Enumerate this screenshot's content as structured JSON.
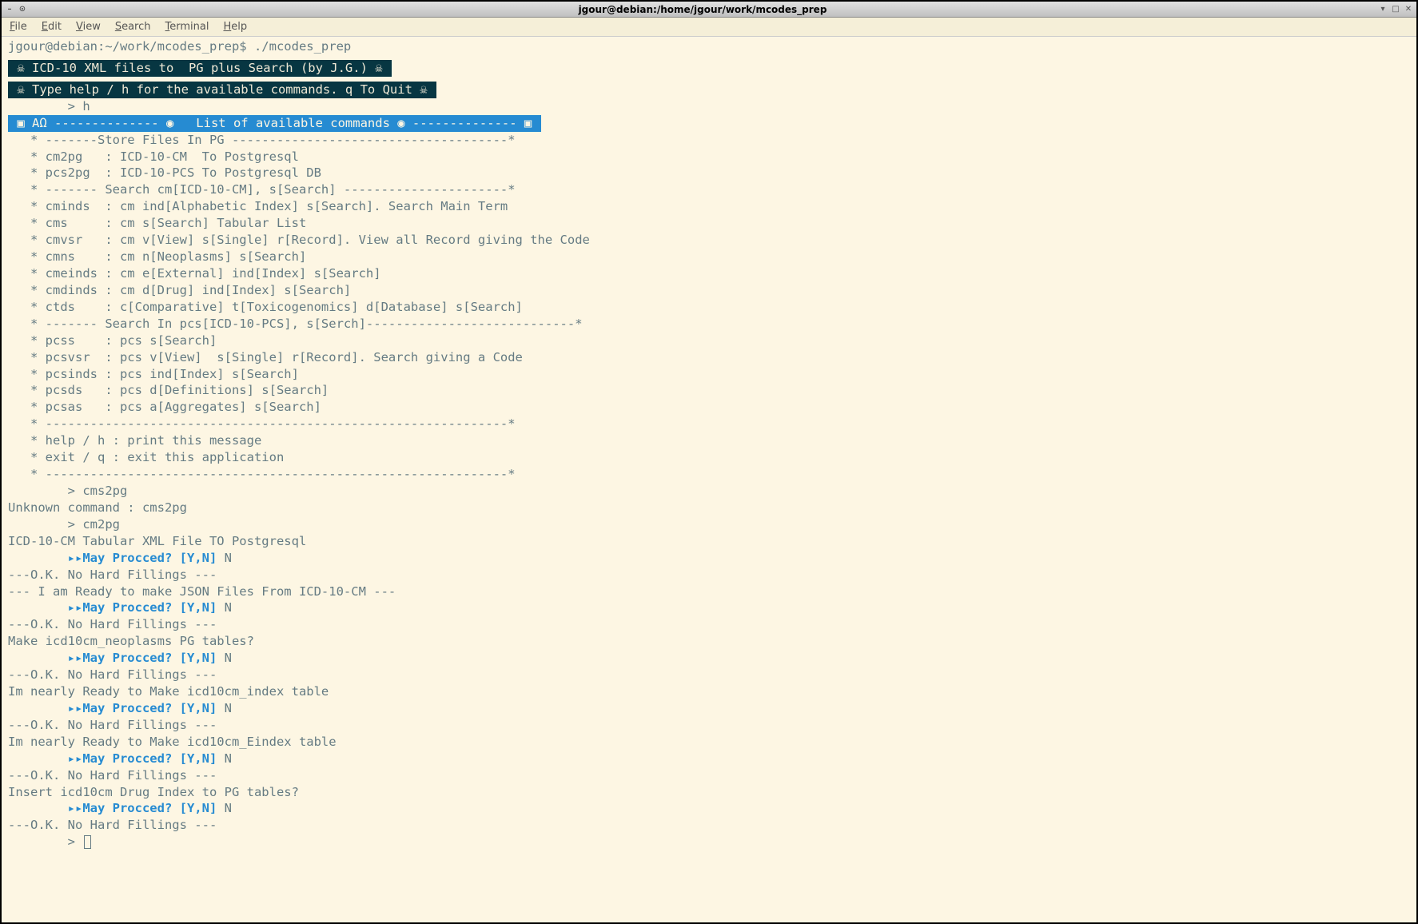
{
  "window": {
    "title": "jgour@debian:/home/jgour/work/mcodes_prep"
  },
  "menu": {
    "items": [
      "File",
      "Edit",
      "View",
      "Search",
      "Terminal",
      "Help"
    ]
  },
  "shell_prompt": "jgour@debian:~/work/mcodes_prep$ ./mcodes_prep",
  "banner1": " ☠ ICD-10 XML files to  PG plus Search (by J.G.) ☠ ",
  "banner2": " ☠ Type help / h for the available commands. q To Quit ☠ ",
  "input1": "        > h",
  "banner3": " ▣ AΩ -------------- ◉   List of available commands ◉ -------------- ▣ ",
  "help_lines": [
    "",
    "   * -------Store Files In PG -------------------------------------*",
    "   * cm2pg   : ICD-10-CM  To Postgresql",
    "   * pcs2pg  : ICD-10-PCS To Postgresql DB",
    "   * ------- Search cm[ICD-10-CM], s[Search] ----------------------*",
    "   * cminds  : cm ind[Alphabetic Index] s[Search]. Search Main Term",
    "   * cms     : cm s[Search] Tabular List",
    "   * cmvsr   : cm v[View] s[Single] r[Record]. View all Record giving the Code",
    "   * cmns    : cm n[Neoplasms] s[Search]",
    "   * cmeinds : cm e[External] ind[Index] s[Search]",
    "   * cmdinds : cm d[Drug] ind[Index] s[Search]",
    "   * ctds    : c[Comparative] t[Toxicogenomics] d[Database] s[Search]",
    "   * ------- Search In pcs[ICD-10-PCS], s[Serch]----------------------------*",
    "   * pcss    : pcs s[Search]",
    "   * pcsvsr  : pcs v[View]  s[Single] r[Record]. Search giving a Code",
    "   * pcsinds : pcs ind[Index] s[Search]",
    "   * pcsds   : pcs d[Definitions] s[Search]",
    "   * pcsas   : pcs a[Aggregates] s[Search]",
    "   * --------------------------------------------------------------*",
    "   * help / h : print this message",
    "   * exit / q : exit this application",
    "   * --------------------------------------------------------------*",
    ""
  ],
  "session": [
    {
      "type": "in",
      "text": "        > cms2pg"
    },
    {
      "type": "out",
      "text": "Unknown command : cms2pg"
    },
    {
      "type": "in",
      "text": "        > cm2pg"
    },
    {
      "type": "out",
      "text": "ICD-10-CM Tabular XML File TO Postgresql"
    },
    {
      "type": "ask",
      "prompt": "▸▸May Procced? [Y,N]",
      "answer": " N"
    },
    {
      "type": "out",
      "text": "---O.K. No Hard Fillings ---"
    },
    {
      "type": "out",
      "text": "--- I am Ready to make JSON Files From ICD-10-CM ---"
    },
    {
      "type": "ask",
      "prompt": "▸▸May Procced? [Y,N]",
      "answer": " N"
    },
    {
      "type": "out",
      "text": "---O.K. No Hard Fillings ---"
    },
    {
      "type": "out",
      "text": "Make icd10cm_neoplasms PG tables?"
    },
    {
      "type": "ask",
      "prompt": "▸▸May Procced? [Y,N]",
      "answer": " N"
    },
    {
      "type": "out",
      "text": "---O.K. No Hard Fillings ---"
    },
    {
      "type": "out",
      "text": "Im nearly Ready to Make icd10cm_index table"
    },
    {
      "type": "ask",
      "prompt": "▸▸May Procced? [Y,N]",
      "answer": " N"
    },
    {
      "type": "out",
      "text": "---O.K. No Hard Fillings ---"
    },
    {
      "type": "out",
      "text": "Im nearly Ready to Make icd10cm_Eindex table"
    },
    {
      "type": "ask",
      "prompt": "▸▸May Procced? [Y,N]",
      "answer": " N"
    },
    {
      "type": "out",
      "text": "---O.K. No Hard Fillings ---"
    },
    {
      "type": "out",
      "text": "Insert icd10cm Drug Index to PG tables?"
    },
    {
      "type": "ask",
      "prompt": "▸▸May Procced? [Y,N]",
      "answer": " N"
    },
    {
      "type": "out",
      "text": "---O.K. No Hard Fillings ---"
    },
    {
      "type": "cursor",
      "text": "        > "
    }
  ]
}
